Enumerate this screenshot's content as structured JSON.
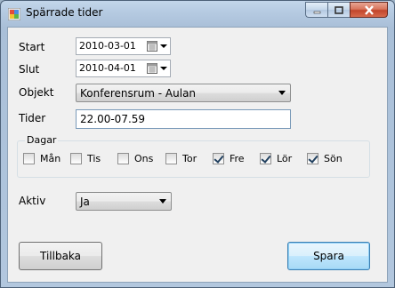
{
  "window": {
    "title": "Spärrade tider"
  },
  "form": {
    "start": {
      "label": "Start",
      "value": "2010-03-01"
    },
    "slut": {
      "label": "Slut",
      "value": "2010-04-01"
    },
    "objekt": {
      "label": "Objekt",
      "value": "Konferensrum - Aulan"
    },
    "tider": {
      "label": "Tider",
      "value": "22.00-07.59"
    },
    "dagar": {
      "label": "Dagar",
      "days": [
        {
          "label": "Mån",
          "checked": false
        },
        {
          "label": "Tis",
          "checked": false
        },
        {
          "label": "Ons",
          "checked": false
        },
        {
          "label": "Tor",
          "checked": false
        },
        {
          "label": "Fre",
          "checked": true
        },
        {
          "label": "Lör",
          "checked": true
        },
        {
          "label": "Sön",
          "checked": true
        }
      ]
    },
    "aktiv": {
      "label": "Aktiv",
      "value": "Ja"
    }
  },
  "buttons": {
    "back": "Tillbaka",
    "save": "Spara"
  },
  "icons": {
    "app": "app-window-icon",
    "calendar": "calendar-icon"
  }
}
